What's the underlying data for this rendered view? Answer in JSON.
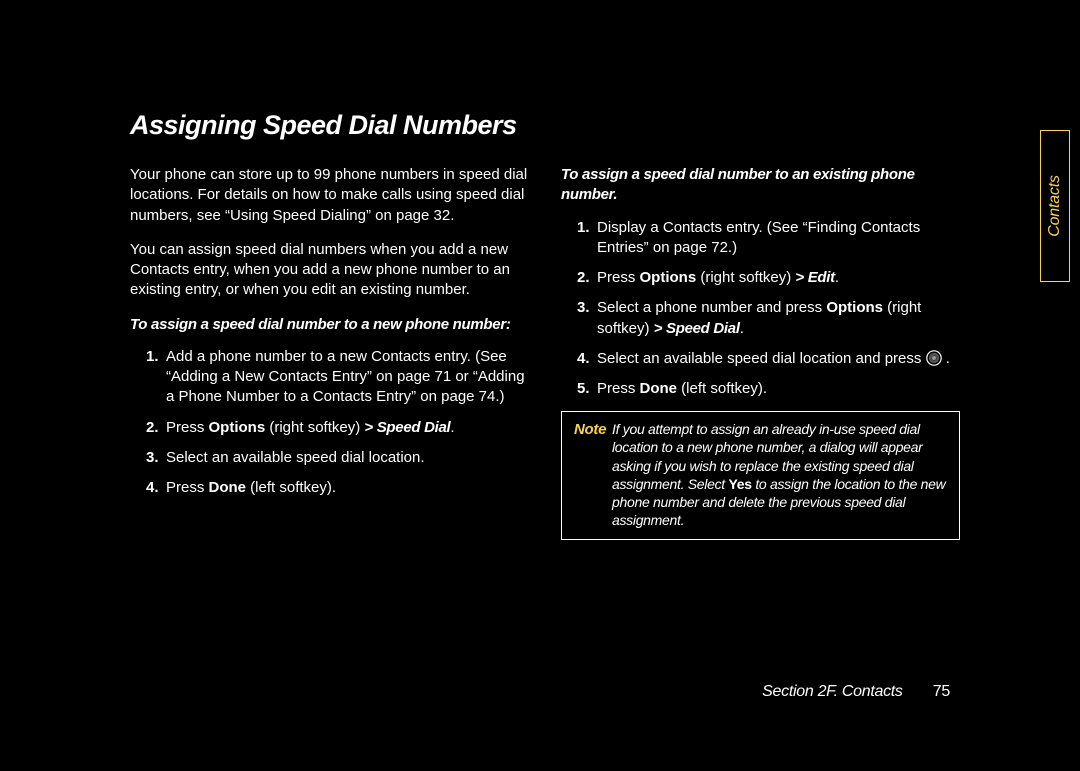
{
  "heading": "Assigning Speed Dial Numbers",
  "left": {
    "p1": "Your phone can store up to 99 phone numbers in speed dial locations. For details on how to make calls using speed dial numbers, see “Using Speed Dialing” on page 32.",
    "p2": "You can assign speed dial numbers when you add a new Contacts entry, when you add a new phone number to an existing entry, or when you edit an existing number.",
    "sub1": "To assign a speed dial number to a new phone number:",
    "steps": [
      {
        "num": "1.",
        "pre": "",
        "text": "Add a phone number to a new Contacts entry. (See “Adding a New Contacts Entry” on page 71 or “Adding a Phone Number to a Contacts Entry” on page 74.)"
      },
      {
        "num": "2.",
        "pre": "Press ",
        "b1": "Options",
        "mid": " (right softkey) ",
        "bi1": "> Speed Dial",
        "post": "."
      },
      {
        "num": "3.",
        "pre": "",
        "text": "Select an available speed dial location."
      },
      {
        "num": "4.",
        "pre": "Press ",
        "b1": "Done",
        "mid": " (left softkey).",
        "post": ""
      }
    ]
  },
  "right": {
    "sub1": "To assign a speed dial number to an existing phone number.",
    "steps": [
      {
        "num": "1.",
        "pre": "",
        "text": "Display a Contacts entry. (See “Finding Contacts Entries” on page 72.)"
      },
      {
        "num": "2.",
        "pre": "Press ",
        "b1": "Options",
        "mid": " (right softkey) ",
        "bi1": "> Edit",
        "post": "."
      },
      {
        "num": "3.",
        "pre": "Select a phone number and press ",
        "b1": "Options",
        "mid": " (right softkey) ",
        "bi1": "> Speed Dial",
        "post": "."
      },
      {
        "num": "4.",
        "pre": "Select an available speed dial location and press ",
        "icon": true,
        "post": " ."
      },
      {
        "num": "5.",
        "pre": "Press ",
        "b1": "Done",
        "mid": " (left softkey).",
        "post": ""
      }
    ],
    "note_label": "Note",
    "note_pre": "If you attempt to assign an already in-use speed dial location to a new phone number, a dialog will appear asking if you wish to replace the existing speed dial assignment. Select ",
    "note_b": "Yes",
    "note_post": " to assign the location to the new phone number and delete the previous speed dial assignment."
  },
  "side_tab": "Contacts",
  "footer_section": "Section 2F. Contacts",
  "footer_page": "75"
}
